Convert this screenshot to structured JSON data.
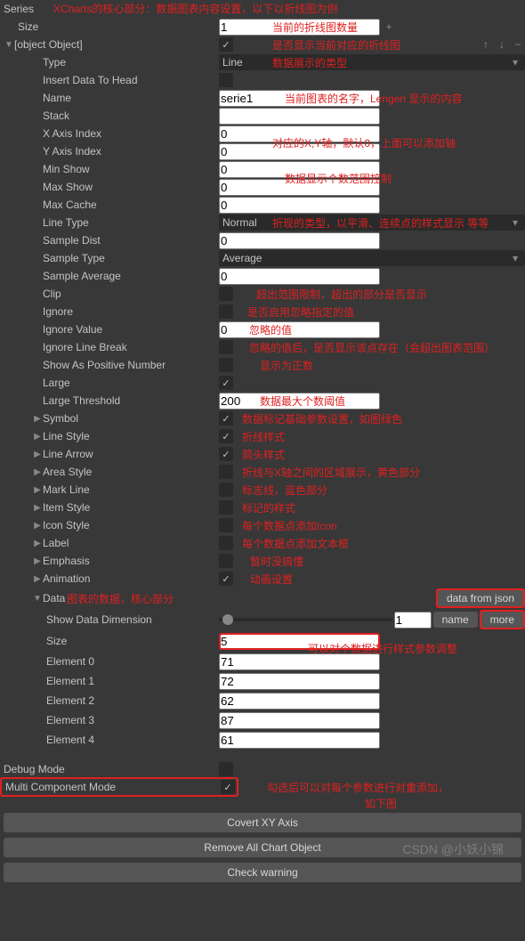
{
  "header": {
    "series": "Series",
    "note": "XCharts的核心部分：数据图表内容设置，以下以折线图为例"
  },
  "size": {
    "label": "Size",
    "value": "1",
    "note": "当前的折线图数量"
  },
  "serie0": {
    "label": {
      "label": "Label",
      "note": "每个数据点添加文本框"
    },
    "note": "是否显示当前对应的折线图",
    "type": {
      "label": "Type",
      "value": "Line",
      "note": "数据展示的类型"
    },
    "insertDataToHead": {
      "label": "Insert Data To Head"
    },
    "name": {
      "label": "Name",
      "value": "serie1",
      "note": "当前图表的名字，Lengen 显示的内容"
    },
    "stack": {
      "label": "Stack",
      "value": ""
    },
    "xAxisIndex": {
      "label": "X Axis Index",
      "value": "0"
    },
    "yAxisIndex": {
      "label": "Y Axis Index",
      "value": "0",
      "note": "对应的X,Y轴，默认0，上面可以添加轴"
    },
    "minShow": {
      "label": "Min Show",
      "value": "0"
    },
    "maxShow": {
      "label": "Max Show",
      "value": "0",
      "note": "数据显示个数范围控制"
    },
    "maxCache": {
      "label": "Max Cache",
      "value": "0"
    },
    "lineType": {
      "label": "Line Type",
      "value": "Normal",
      "note": "折现的类型，以平滑、连续点的样式显示 等等"
    },
    "sampleDist": {
      "label": "Sample Dist",
      "value": "0"
    },
    "sampleType": {
      "label": "Sample Type",
      "value": "Average"
    },
    "sampleAverage": {
      "label": "Sample Average",
      "value": "0"
    },
    "clip": {
      "label": "Clip",
      "note": "超出范围限制，超出的部分是否显示"
    },
    "ignore": {
      "label": "Ignore",
      "note": "是否启用忽略指定的值"
    },
    "ignoreValue": {
      "label": "Ignore Value",
      "value": "0",
      "note": "忽略的值"
    },
    "ignoreLineBreak": {
      "label": "Ignore Line Break",
      "note": "忽略的值后，是否显示该点存在（会超出图表范围）"
    },
    "showAsPositiveNumber": {
      "label": "Show As Positive Number",
      "note": "显示为正数"
    },
    "large": {
      "label": "Large"
    },
    "largeThreshold": {
      "label": "Large Threshold",
      "value": "200",
      "note": "数据最大个数阈值"
    },
    "symbol": {
      "label": "Symbol",
      "note": "数据标记基础参数设置，如图绿色"
    },
    "lineStyle": {
      "label": "Line Style",
      "note": "折线样式"
    },
    "lineArrow": {
      "label": "Line Arrow",
      "note": "箭头样式"
    },
    "areaStyle": {
      "label": "Area Style",
      "note": "折线与X轴之间的区域展示，黄色部分"
    },
    "markLine": {
      "label": "Mark Line",
      "note": "标志线，蓝色部分"
    },
    "itemStyle": {
      "label": "Item Style",
      "note": "标记的样式"
    },
    "iconStyle": {
      "label": "Icon Style",
      "note": "每个数据点添加Icon"
    },
    "emphasis": {
      "label": "Emphasis",
      "note": "暂时没搞懂"
    },
    "animation": {
      "label": "Animation",
      "note": "动画设置"
    }
  },
  "data": {
    "label": "Data",
    "note": "图表的数据，核心部分",
    "dataFromJson": "data from json",
    "showDataDimension": {
      "label": "Show Data Dimension",
      "value": "1",
      "nameBtn": "name",
      "moreBtn": "more"
    },
    "sizeOverlay": "可以对个数据进行样式参数调整",
    "size": {
      "label": "Size",
      "value": "5"
    },
    "elements": [
      {
        "label": "Element 0",
        "value": "71"
      },
      {
        "label": "Element 1",
        "value": "72"
      },
      {
        "label": "Element 2",
        "value": "62"
      },
      {
        "label": "Element 3",
        "value": "87"
      },
      {
        "label": "Element 4",
        "value": "61"
      }
    ]
  },
  "footer": {
    "debugMode": {
      "label": "Debug Mode"
    },
    "multiComponentMode": {
      "label": "Multi Component Mode",
      "note1": "勾选后可以对每个参数进行对重添加，",
      "note2": "如下图"
    },
    "btn1": "Covert XY Axis",
    "btn2": "Remove All Chart Object",
    "btn3": "Check warning",
    "watermark": "CSDN @小妖小锦"
  }
}
